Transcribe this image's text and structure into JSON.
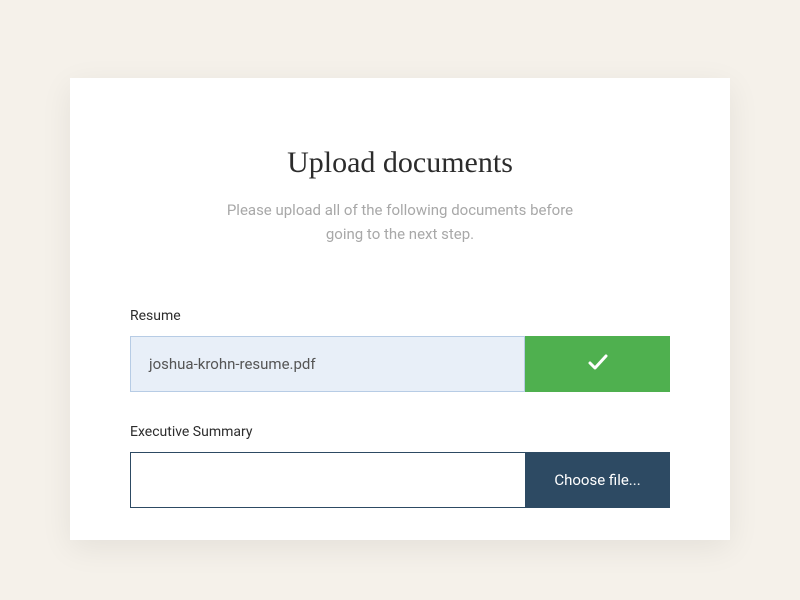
{
  "heading": "Upload documents",
  "subheading": "Please upload all of the following documents before going to the next step.",
  "fields": [
    {
      "label": "Resume",
      "filename": "joshua-krohn-resume.pdf",
      "status": "uploaded"
    },
    {
      "label": "Executive Summary",
      "filename": "",
      "status": "empty",
      "button_label": "Choose file..."
    }
  ]
}
